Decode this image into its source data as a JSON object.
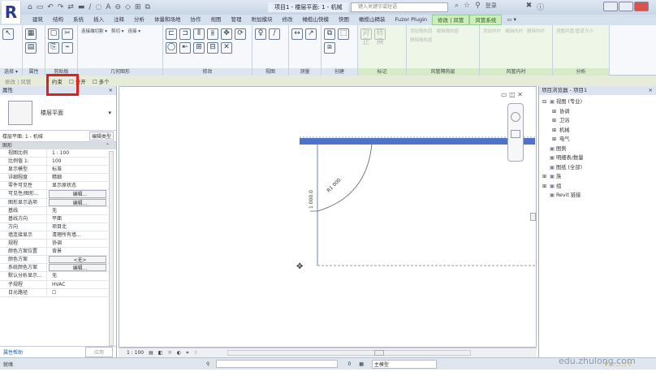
{
  "app": {
    "logo": "R",
    "title": "项目1 - 楼层平面: 1 - 机械",
    "search_placeholder": "键入关键字或短语",
    "user": "登录"
  },
  "quick_access": [
    "⌂",
    "▭",
    "↶",
    "↷",
    "⇄",
    "▬",
    "∕",
    "◌",
    "A",
    "⊖",
    "◇",
    "⊞",
    "⧉"
  ],
  "tabs": [
    "建筑",
    "结构",
    "系统",
    "插入",
    "注释",
    "分析",
    "体量和场地",
    "协作",
    "视图",
    "管理",
    "附加模块",
    "修改",
    "橄榄山快模",
    "快图",
    "橄榄山精装",
    "Fuzor Plugin",
    "修改 | 风管",
    "风管系统",
    "▭ ▾"
  ],
  "active_tabs": [
    "修改 | 风管",
    "风管系统"
  ],
  "ribbon_panels": [
    {
      "label": "选择 ▾",
      "icons": [
        "↖"
      ],
      "caption": "修改"
    },
    {
      "label": "属性",
      "icons": [
        "▦",
        "▤"
      ]
    },
    {
      "label": "剪贴板",
      "icons": [
        "▢",
        "✂",
        "⎘",
        "⌁"
      ],
      "caption": "粘贴"
    },
    {
      "label": "几何图形",
      "icons": [
        "连接端切割 ▾",
        "剪切 ▾",
        "连接 ▾"
      ]
    },
    {
      "label": "修改",
      "icons": [
        "⊏",
        "⊐",
        "⫴",
        "⫵",
        "✥",
        "⟳",
        "◯",
        "⇤",
        "⊞",
        "⊟",
        "✕"
      ]
    },
    {
      "label": "视图",
      "icons": [
        "♀",
        "∕"
      ]
    },
    {
      "label": "测量",
      "icons": [
        "↔",
        "↗"
      ]
    },
    {
      "label": "创建",
      "icons": [
        "⧉",
        "⬚",
        "⧈"
      ]
    },
    {
      "label": "标记",
      "icons": [
        "对正",
        "转换"
      ],
      "disabled": true
    },
    {
      "label": "风管隔热层",
      "icons": [
        "添加隔热层",
        "编辑隔热层",
        "删除隔热层"
      ],
      "disabled": true
    },
    {
      "label": "风管内衬",
      "icons": [
        "添加内衬",
        "编辑内衬",
        "删除内衬"
      ],
      "disabled": true
    },
    {
      "label": "分析",
      "icons": [
        "调整风管/管道大小"
      ],
      "disabled": true
    }
  ],
  "options_bar": {
    "mode": "修改 | 风管",
    "items": [
      {
        "label": "约束",
        "checked": true
      },
      {
        "label": "分开",
        "checked": false
      },
      {
        "label": "多个",
        "checked": false
      }
    ]
  },
  "properties": {
    "title": "属性",
    "type_name": "楼层平面",
    "filter": "楼层平面: 1 - 机械",
    "edit_type": "编辑类型",
    "group": "图形",
    "rows": [
      {
        "k": "视图比例",
        "v": "1 : 100"
      },
      {
        "k": "比例值 1:",
        "v": "100"
      },
      {
        "k": "显示模型",
        "v": "标准"
      },
      {
        "k": "详细程度",
        "v": "精细"
      },
      {
        "k": "零件可见性",
        "v": "显示原状态"
      },
      {
        "k": "可见性/图形...",
        "v": "编辑...",
        "btn": true
      },
      {
        "k": "图形显示选项",
        "v": "编辑...",
        "btn": true
      },
      {
        "k": "基线",
        "v": "无"
      },
      {
        "k": "基线方向",
        "v": "平面"
      },
      {
        "k": "方向",
        "v": "项目北"
      },
      {
        "k": "墙连接显示",
        "v": "清理所有墙..."
      },
      {
        "k": "规程",
        "v": "协调"
      },
      {
        "k": "颜色方案位置",
        "v": "背景"
      },
      {
        "k": "颜色方案",
        "v": "<无>",
        "btn": true
      },
      {
        "k": "系统颜色方案",
        "v": "编辑...",
        "btn": true
      },
      {
        "k": "默认分析显示...",
        "v": "无"
      },
      {
        "k": "子规程",
        "v": "HVAC"
      },
      {
        "k": "日光路径",
        "v": "☐"
      }
    ],
    "help": "属性帮助",
    "apply": "应用"
  },
  "canvas": {
    "dim_arc": "R1 000.",
    "dim_vertical": "1 000.0",
    "duct_color": "#4f73c9"
  },
  "browser": {
    "title": "项目浏览器 - 项目1",
    "items": [
      {
        "label": "视图 (专业)",
        "level": 0,
        "toggle": "⊟"
      },
      {
        "label": "协调",
        "level": 1,
        "toggle": "⊞"
      },
      {
        "label": "卫浴",
        "level": 1,
        "toggle": "⊞"
      },
      {
        "label": "机械",
        "level": 1,
        "toggle": "⊞"
      },
      {
        "label": "电气",
        "level": 1,
        "toggle": "⊞"
      },
      {
        "label": "图例",
        "level": 0,
        "toggle": ""
      },
      {
        "label": "明细表/数量",
        "level": 0,
        "toggle": ""
      },
      {
        "label": "图纸 (全部)",
        "level": 0,
        "toggle": ""
      },
      {
        "label": "族",
        "level": 0,
        "toggle": "⊞"
      },
      {
        "label": "组",
        "level": 0,
        "toggle": "⊞"
      },
      {
        "label": "Revit 链接",
        "level": 0,
        "toggle": ""
      }
    ]
  },
  "view_bar": {
    "scale": "1 : 100"
  },
  "status": {
    "left": "就绪",
    "model": "主模型",
    "count": "0"
  },
  "watermark": "edu.zhulong.com"
}
